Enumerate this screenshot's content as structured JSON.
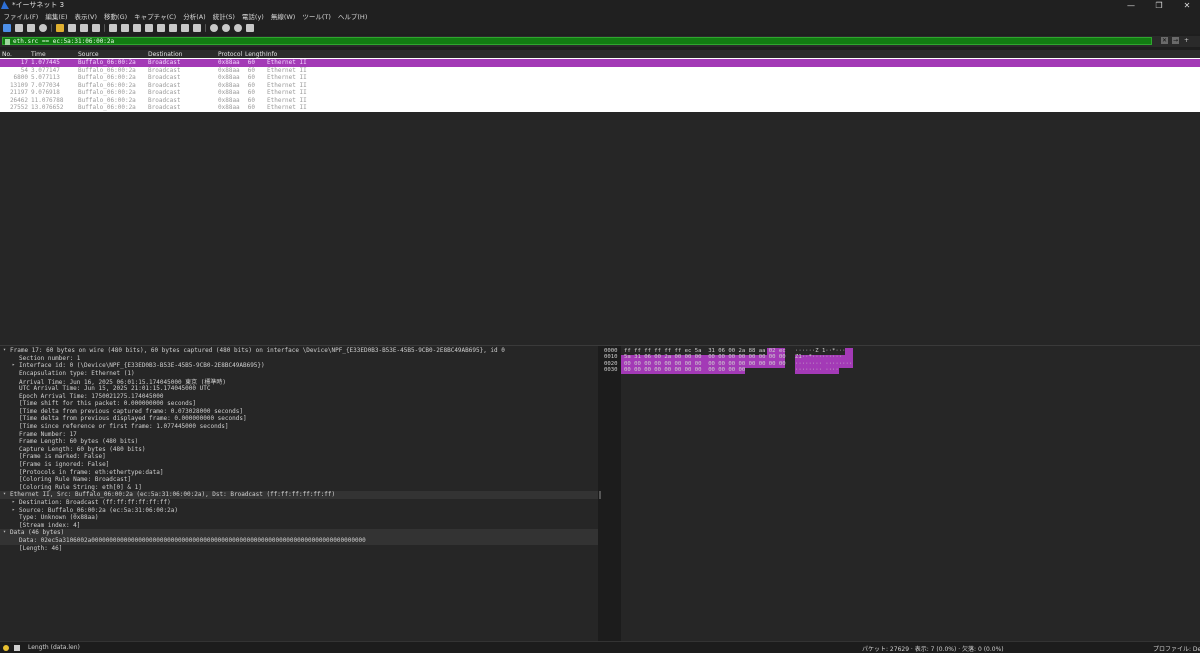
{
  "window": {
    "title": "*イーサネット 3",
    "controls": [
      "—",
      "❐",
      "✕"
    ]
  },
  "menu": [
    "ファイル(F)",
    "編集(E)",
    "表示(V)",
    "移動(G)",
    "キャプチャ(C)",
    "分析(A)",
    "統計(S)",
    "電話(y)",
    "無線(W)",
    "ツール(T)",
    "ヘルプ(H)"
  ],
  "toolbar_icons": [
    "shark-fin-start-icon",
    "stop-icon",
    "restart-icon",
    "options-gear-icon",
    "open-file-icon",
    "save-icon",
    "close-file-icon",
    "reload-icon",
    "find-icon",
    "back-icon",
    "forward-icon",
    "go-to-packet-icon",
    "first-packet-icon",
    "last-packet-icon",
    "autoscroll-icon",
    "colorize-icon",
    "zoom-in-icon",
    "zoom-out-icon",
    "zoom-normal-icon",
    "resize-columns-icon"
  ],
  "filter": {
    "value": "eth.src == ec:5a:31:06:00:2a",
    "clear": "✕",
    "apply": "→",
    "add": "+"
  },
  "packet_list": {
    "columns": [
      "No.",
      "Time",
      "Source",
      "Destination",
      "Protocol",
      "Length",
      "Info"
    ],
    "rows": [
      {
        "no": "17",
        "time": "1.077445",
        "source": "Buffalo_06:00:2a",
        "destination": "Broadcast",
        "protocol": "0x88aa",
        "length": "60",
        "info": "Ethernet II",
        "selected": true
      },
      {
        "no": "54",
        "time": "3.077147",
        "source": "Buffalo_06:00:2a",
        "destination": "Broadcast",
        "protocol": "0x88aa",
        "length": "60",
        "info": "Ethernet II",
        "selected": false
      },
      {
        "no": "6800",
        "time": "5.077113",
        "source": "Buffalo_06:00:2a",
        "destination": "Broadcast",
        "protocol": "0x88aa",
        "length": "60",
        "info": "Ethernet II",
        "selected": false
      },
      {
        "no": "13109",
        "time": "7.077034",
        "source": "Buffalo_06:00:2a",
        "destination": "Broadcast",
        "protocol": "0x88aa",
        "length": "60",
        "info": "Ethernet II",
        "selected": false
      },
      {
        "no": "21197",
        "time": "9.076918",
        "source": "Buffalo_06:00:2a",
        "destination": "Broadcast",
        "protocol": "0x88aa",
        "length": "60",
        "info": "Ethernet II",
        "selected": false
      },
      {
        "no": "26462",
        "time": "11.076788",
        "source": "Buffalo_06:00:2a",
        "destination": "Broadcast",
        "protocol": "0x88aa",
        "length": "60",
        "info": "Ethernet II",
        "selected": false
      },
      {
        "no": "27552",
        "time": "13.076652",
        "source": "Buffalo_06:00:2a",
        "destination": "Broadcast",
        "protocol": "0x88aa",
        "length": "60",
        "info": "Ethernet II",
        "selected": false
      }
    ]
  },
  "details": [
    {
      "arrow": "▾",
      "indent": 0,
      "text": "Frame 17: 60 bytes on wire (480 bits), 60 bytes captured (480 bits) on interface \\Device\\NPF_{E33ED0B3-B53E-45B5-9CB0-2E8BC49AB695}, id 0"
    },
    {
      "arrow": "",
      "indent": 1,
      "text": "Section number: 1"
    },
    {
      "arrow": "▸",
      "indent": 1,
      "text": "Interface id: 0 (\\Device\\NPF_{E33ED0B3-B53E-45B5-9CB0-2E8BC49AB695})"
    },
    {
      "arrow": "",
      "indent": 1,
      "text": "Encapsulation type: Ethernet (1)"
    },
    {
      "arrow": "",
      "indent": 1,
      "text": "Arrival Time: Jun 16, 2025 06:01:15.174045000 東京 (標準時)"
    },
    {
      "arrow": "",
      "indent": 1,
      "text": "UTC Arrival Time: Jun 15, 2025 21:01:15.174045000 UTC"
    },
    {
      "arrow": "",
      "indent": 1,
      "text": "Epoch Arrival Time: 1750021275.174045000"
    },
    {
      "arrow": "",
      "indent": 1,
      "text": "[Time shift for this packet: 0.000000000 seconds]"
    },
    {
      "arrow": "",
      "indent": 1,
      "text": "[Time delta from previous captured frame: 0.073028000 seconds]"
    },
    {
      "arrow": "",
      "indent": 1,
      "text": "[Time delta from previous displayed frame: 0.000000000 seconds]"
    },
    {
      "arrow": "",
      "indent": 1,
      "text": "[Time since reference or first frame: 1.077445000 seconds]"
    },
    {
      "arrow": "",
      "indent": 1,
      "text": "Frame Number: 17"
    },
    {
      "arrow": "",
      "indent": 1,
      "text": "Frame Length: 60 bytes (480 bits)"
    },
    {
      "arrow": "",
      "indent": 1,
      "text": "Capture Length: 60 bytes (480 bits)"
    },
    {
      "arrow": "",
      "indent": 1,
      "text": "[Frame is marked: False]"
    },
    {
      "arrow": "",
      "indent": 1,
      "text": "[Frame is ignored: False]"
    },
    {
      "arrow": "",
      "indent": 1,
      "text": "[Protocols in frame: eth:ethertype:data]"
    },
    {
      "arrow": "",
      "indent": 1,
      "text": "[Coloring Rule Name: Broadcast]"
    },
    {
      "arrow": "",
      "indent": 1,
      "text": "[Coloring Rule String: eth[0] & 1]"
    },
    {
      "arrow": "▾",
      "indent": 0,
      "text": "Ethernet II, Src: Buffalo_06:00:2a (ec:5a:31:06:00:2a), Dst: Broadcast (ff:ff:ff:ff:ff:ff)"
    },
    {
      "arrow": "▸",
      "indent": 1,
      "text": "Destination: Broadcast (ff:ff:ff:ff:ff:ff)"
    },
    {
      "arrow": "▸",
      "indent": 1,
      "text": "Source: Buffalo_06:00:2a (ec:5a:31:06:00:2a)"
    },
    {
      "arrow": "",
      "indent": 1,
      "text": "Type: Unknown (0x88aa)"
    },
    {
      "arrow": "",
      "indent": 1,
      "text": "[Stream index: 4]"
    },
    {
      "arrow": "▾",
      "indent": 0,
      "text": "Data (46 bytes)"
    },
    {
      "arrow": "",
      "indent": 1,
      "text": "Data: 02ec5a3106002a0000000000000000000000000000000000000000000000000000000000000000000000000000"
    },
    {
      "arrow": "",
      "indent": 1,
      "text": "[Length: 46]"
    }
  ],
  "bytes": {
    "offsets": [
      "0000",
      "0010",
      "0020",
      "0030"
    ],
    "hex": [
      "ff ff ff ff ff ff ec 5a  31 06 00 2a 88 aa 02 ec",
      "5a 31 06 00 2a 00 00 00  00 00 00 00 00 00 00 00",
      "00 00 00 00 00 00 00 00  00 00 00 00 00 00 00 00",
      "00 00 00 00 00 00 00 00  00 00 00 00"
    ],
    "ascii": [
      "······Z 1··*···",
      "Z1··*·········",
      "········ ········",
      "········ ····"
    ]
  },
  "status": {
    "field": "Length (data.len)",
    "packets": "パケット: 27629 · 表示: 7 (0.0%) · 欠落: 0 (0.0%)",
    "profile": "プロファイル: Default"
  },
  "colors": {
    "selected_row": "#a33ab6",
    "filter_bg": "#127c12",
    "pane_bg": "#262626"
  }
}
